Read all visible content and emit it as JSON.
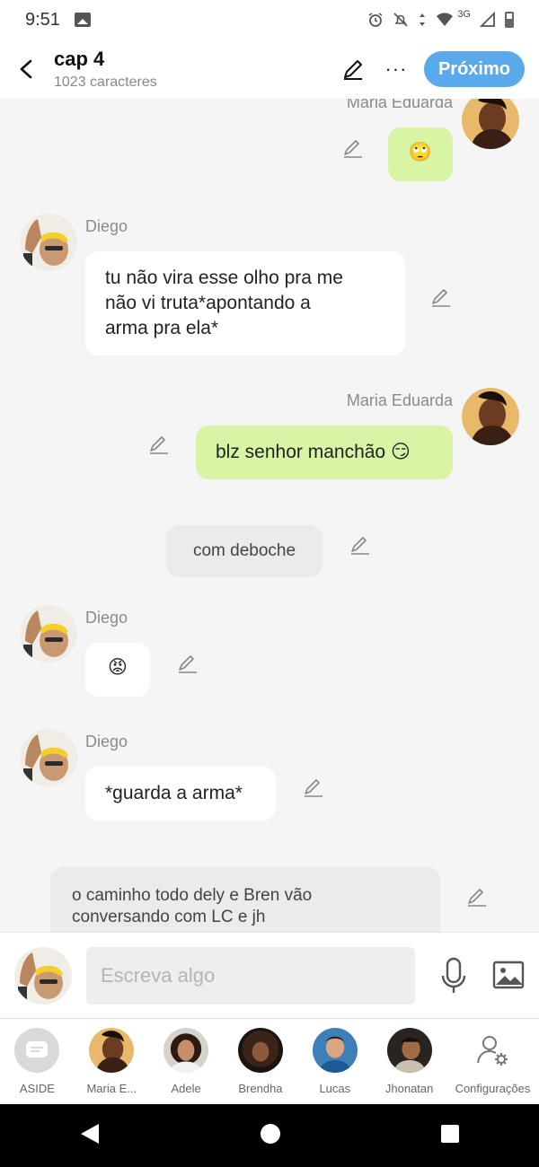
{
  "status": {
    "time": "9:51",
    "network": "3G"
  },
  "header": {
    "title": "cap 4",
    "subtitle": "1023 caracteres",
    "next_label": "Próximo"
  },
  "messages": [
    {
      "sender": "Maria Eduarda",
      "side": "right",
      "text": "🙄"
    },
    {
      "sender": "Diego",
      "side": "left",
      "text_lines": [
        "tu não vira esse olho pra me",
        "não vi truta*apontando a",
        "arma pra ela*"
      ]
    },
    {
      "sender": "Maria Eduarda",
      "side": "right",
      "text": "blz senhor manchão 😏"
    },
    {
      "sender": "",
      "side": "center",
      "text": "com deboche"
    },
    {
      "sender": "Diego",
      "side": "left",
      "text": "😡"
    },
    {
      "sender": "Diego",
      "side": "left",
      "text": "*guarda a arma*"
    },
    {
      "sender": "",
      "side": "narration",
      "text_lines": [
        "o caminho todo dely e Bren vão",
        "conversando com LC e jh"
      ]
    }
  ],
  "composer": {
    "placeholder": "Escreva algo"
  },
  "tabs": [
    {
      "label": "ASIDE",
      "icon": "chat-bubble-icon"
    },
    {
      "label": "Maria E..."
    },
    {
      "label": "Adele"
    },
    {
      "label": "Brendha"
    },
    {
      "label": "Lucas"
    },
    {
      "label": "Jhonatan"
    },
    {
      "label": "Configurações",
      "icon": "user-settings-icon"
    }
  ],
  "colors": {
    "accent": "#5aa9ea",
    "sent_bubble": "#d8f5a6",
    "received_bubble": "#ffffff",
    "narration_bubble": "#ebebeb"
  }
}
